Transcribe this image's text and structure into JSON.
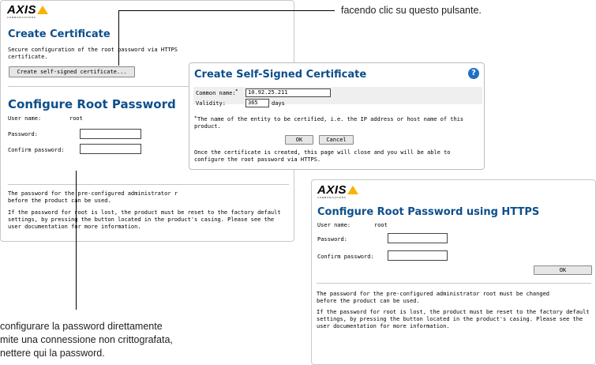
{
  "callouts": {
    "top_right": "facendo clic su questo pulsante.",
    "bottom_left": [
      "configurare la password direttamente",
      "mite una connessione non crittografata,",
      "nettere qui la password."
    ]
  },
  "panel1": {
    "logo": "AXIS",
    "logo_sub": "COMMUNICATIONS",
    "title": "Create Certificate",
    "desc": [
      "Secure configuration of the root password via HTTPS",
      "certificate."
    ],
    "create_button": "Create self-signed certificate...",
    "section_title": "Configure Root Password",
    "user_name_label": "User name:",
    "user_name_value": "root",
    "password_label": "Password:",
    "confirm_label": "Confirm password:",
    "note1": [
      "The password for the pre-configured administrator r",
      "before the product can be used."
    ],
    "note2": [
      "If the password for root is lost, the product must be reset to the factory default",
      "settings, by pressing the button located in the product's casing. Please see the",
      "user documentation for more information."
    ]
  },
  "dialog": {
    "title": "Create Self-Signed Certificate",
    "help_icon": "?",
    "common_name_label": "Common name:",
    "common_name_value": "10.92.25.211",
    "validity_label": "Validity:",
    "validity_value": "365",
    "days_label": "days",
    "footnote": [
      "The name of the entity to be certified, i.e. the IP address or host name of this",
      "product."
    ],
    "ok": "OK",
    "cancel": "Cancel",
    "info": [
      "Once the certificate is created, this page will close and you will be able to",
      "configure the root password via HTTPS."
    ]
  },
  "panel3": {
    "logo": "AXIS",
    "logo_sub": "COMMUNICATIONS",
    "title": "Configure Root Password using HTTPS",
    "user_name_label": "User name:",
    "user_name_value": "root",
    "password_label": "Password:",
    "confirm_label": "Confirm password:",
    "ok": "OK",
    "note1": [
      "The password for the pre-configured administrator root must be changed",
      "before the product can be used."
    ],
    "note2": [
      "If the password for root is lost, the product must be reset to the factory default",
      "settings, by pressing the button located in the product's casing. Please see the",
      "user documentation for more information."
    ]
  },
  "colors": {
    "title_blue": "#0d4f8b",
    "logo_yellow": "#f6b400",
    "help_blue": "#1f6fc4"
  }
}
